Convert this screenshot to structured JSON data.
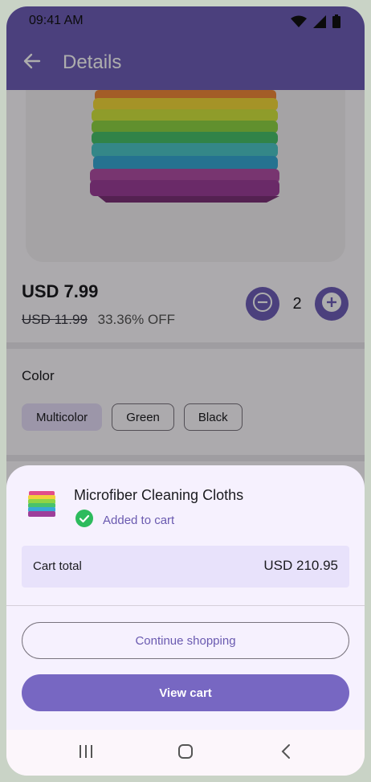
{
  "status_bar": {
    "time": "09:41 AM",
    "icons": [
      "wifi-icon",
      "signal-icon",
      "battery-icon"
    ]
  },
  "app_bar": {
    "title": "Details",
    "back_icon": "arrow-back-icon"
  },
  "product": {
    "price": "USD 7.99",
    "original_price": "USD 11.99",
    "discount": "33.36% OFF",
    "quantity": "2"
  },
  "color_section": {
    "label": "Color",
    "options": [
      "Multicolor",
      "Green",
      "Black"
    ],
    "selected": "Multicolor"
  },
  "sheet": {
    "product_name": "Microfiber Cleaning Cloths",
    "status": "Added to cart",
    "total_label": "Cart total",
    "total_value": "USD 210.95",
    "continue_label": "Continue shopping",
    "view_cart_label": "View cart"
  },
  "colors": {
    "primary": "#6f5fb8",
    "button": "#7767c2",
    "success": "#2dbb5d",
    "sheet_bg": "#f6f1fe"
  }
}
